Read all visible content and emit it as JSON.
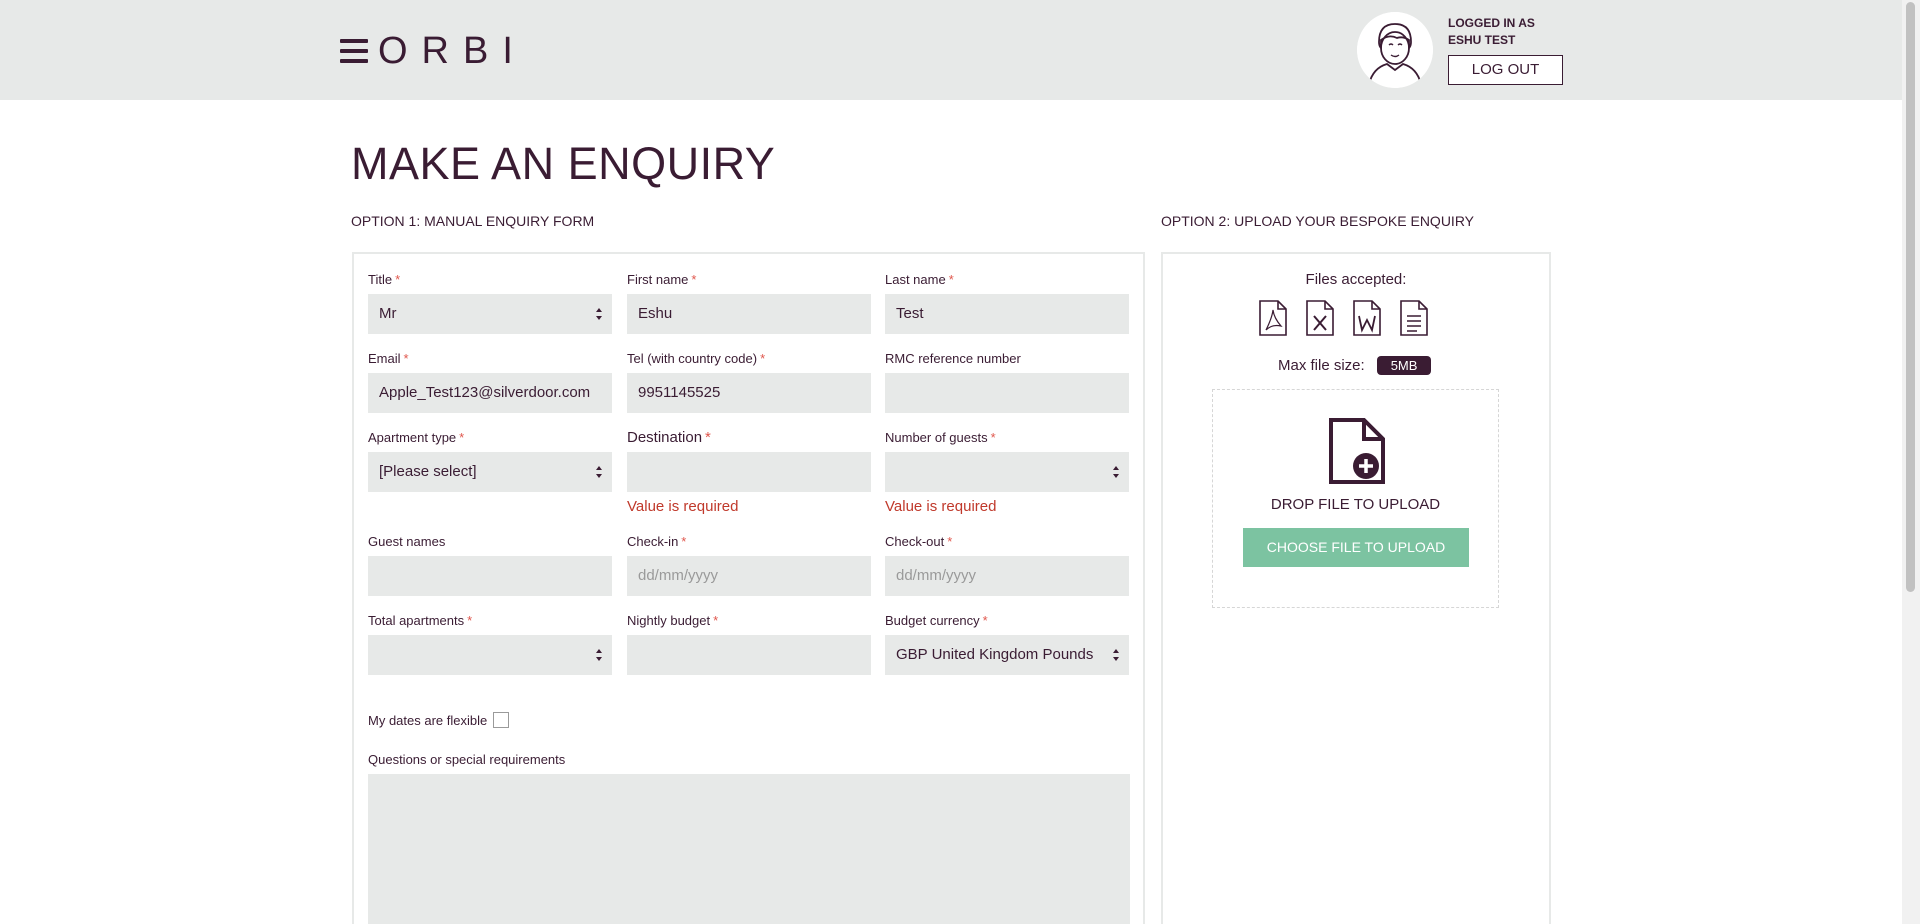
{
  "header": {
    "logo": "ORBI",
    "logged_in_line1": "LOGGED IN AS",
    "logged_in_line2": "ESHU TEST",
    "logout_label": "LOG OUT"
  },
  "page_title": "MAKE AN ENQUIRY",
  "option1_label": "OPTION 1: MANUAL ENQUIRY FORM",
  "option2_label": "OPTION 2: UPLOAD YOUR BESPOKE ENQUIRY",
  "form": {
    "title": {
      "label": "Title",
      "required": "*",
      "value": "Mr"
    },
    "first_name": {
      "label": "First name",
      "required": "*",
      "value": "Eshu"
    },
    "last_name": {
      "label": "Last name",
      "required": "*",
      "value": "Test"
    },
    "email": {
      "label": "Email",
      "required": "*",
      "value": "Apple_Test123@silverdoor.com"
    },
    "tel": {
      "label": "Tel (with country code)",
      "required": "*",
      "value": "9951145525"
    },
    "rmc": {
      "label": "RMC reference number",
      "value": ""
    },
    "apartment_type": {
      "label": "Apartment type",
      "required": "*",
      "value": "[Please select]"
    },
    "destination": {
      "label": "Destination",
      "required": "*",
      "value": "",
      "error": "Value is required"
    },
    "guests": {
      "label": "Number of guests",
      "required": "*",
      "value": "",
      "error": "Value is required"
    },
    "guest_names": {
      "label": "Guest names",
      "value": ""
    },
    "check_in": {
      "label": "Check-in",
      "required": "*",
      "placeholder": "dd/mm/yyyy"
    },
    "check_out": {
      "label": "Check-out",
      "required": "*",
      "placeholder": "dd/mm/yyyy"
    },
    "total_apartments": {
      "label": "Total apartments",
      "required": "*",
      "value": ""
    },
    "nightly_budget": {
      "label": "Nightly budget",
      "required": "*",
      "value": ""
    },
    "budget_currency": {
      "label": "Budget currency",
      "required": "*",
      "value": "GBP United Kingdom Pounds"
    },
    "flexible_label": "My dates are flexible",
    "questions_label": "Questions or special requirements"
  },
  "upload": {
    "files_accepted": "Files accepted:",
    "file_types": [
      "pdf-file-icon",
      "excel-file-icon",
      "word-file-icon",
      "text-file-icon"
    ],
    "max_size_label": "Max file size:",
    "max_size_value": "5MB",
    "drop_text": "DROP FILE TO UPLOAD",
    "choose_label": "CHOOSE FILE TO UPLOAD"
  },
  "colors": {
    "brand": "#3a1c33",
    "field_bg": "#e7e9e8",
    "accent_green": "#7cc3a1",
    "error": "#c0392b",
    "required": "#e0564c"
  }
}
